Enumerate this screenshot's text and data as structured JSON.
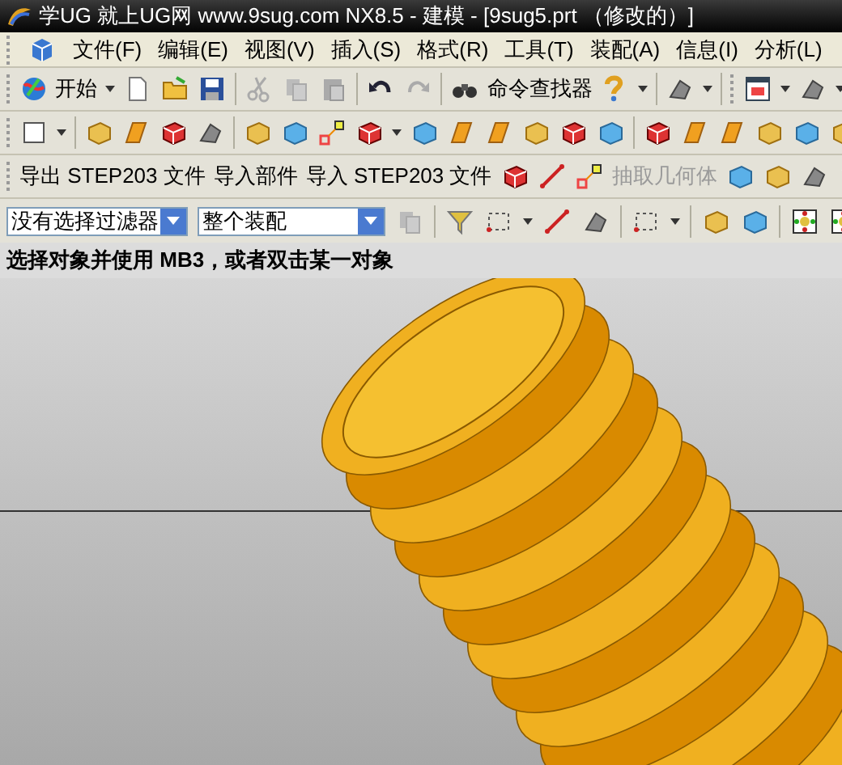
{
  "window": {
    "title": "学UG 就上UG网  www.9sug.com NX8.5 - 建模 - [9sug5.prt （修改的）]"
  },
  "menu": [
    "文件(F)",
    "编辑(E)",
    "视图(V)",
    "插入(S)",
    "格式(R)",
    "工具(T)",
    "装配(A)",
    "信息(I)",
    "分析(L)"
  ],
  "standard_toolbar": {
    "start_button": "开始",
    "command_finder": "命令查找器"
  },
  "file_toolbar": [
    {
      "label": "导出 STEP203 文件",
      "disabled": false
    },
    {
      "label": "导入部件",
      "disabled": false
    },
    {
      "label": "导入 STEP203 文件",
      "disabled": false
    },
    {
      "label": "抽取几何体",
      "disabled": true
    }
  ],
  "selection_bar": {
    "type_filter": "没有选择过滤器",
    "scope": "整个装配"
  },
  "status_bar": "选择对象并使用 MB3，或者双击某一对象"
}
